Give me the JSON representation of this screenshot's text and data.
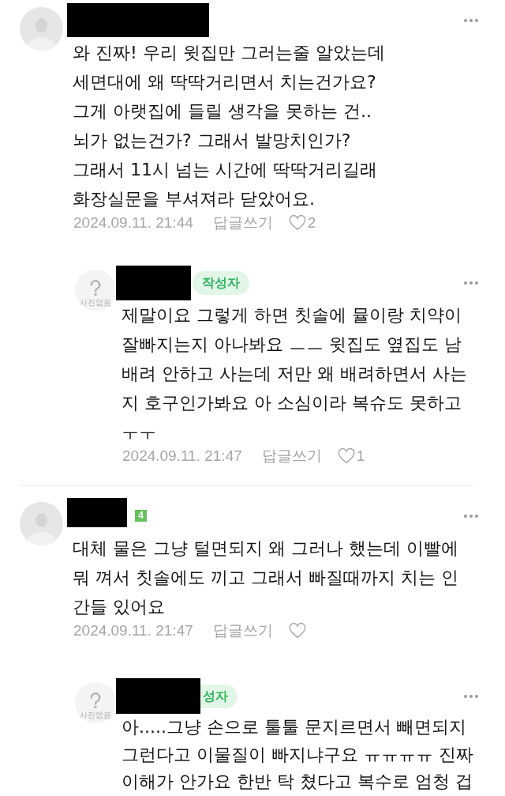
{
  "threads": [
    {
      "comment": {
        "avatar": {
          "kind": "silhouette"
        },
        "name_redacted": true,
        "text": "와 진짜! 우리 윗집만 그러는줄 알았는데\n세면대에 왜 딱딱거리면서 치는건가요?\n그게 아랫집에 들릴 생각을 못하는 건..\n뇌가 없는건가? 그래서 발망치인가?\n그래서 11시 넘는 시간에 딱딱거리길래\n화장실문을 부셔져라 닫았어요.",
        "date": "2024.09.11. 21:44",
        "reply_label": "답글쓰기",
        "likes": "2"
      },
      "replies": [
        {
          "avatar": {
            "kind": "no_photo",
            "caption": "사진없음"
          },
          "name_redacted": true,
          "author_badge": {
            "text": "작성자",
            "covered": false
          },
          "text": "제말이요 그렇게 하면 칫솔에 뮬이랑 치약이\n잘빠지는지 아나봐요 ㅡㅡ 윗집도 옆집도 남\n배려 안하고 사는데 저만 왜 배려하면서 사는\n지 호구인가봐요 아 소심이라 복슈도 못하고\nㅜㅜ",
          "date": "2024.09.11. 21:47",
          "reply_label": "답글쓰기",
          "likes": "1"
        }
      ]
    },
    {
      "comment": {
        "avatar": {
          "kind": "silhouette"
        },
        "name_redacted": true,
        "level_badge": "4",
        "text": "대체 물은 그냥 털면되지 왜 그러나 했는데 이빨에\n뭐 껴서 칫솔에도 끼고 그래서 빠질때까지 치는 인\n간들 있어요",
        "date": "2024.09.11. 21:47",
        "reply_label": "답글쓰기"
      },
      "replies": [
        {
          "avatar": {
            "kind": "no_photo",
            "caption": "사진없음"
          },
          "name_redacted": true,
          "author_badge": {
            "text": "성자",
            "covered": true
          },
          "text": "아.....그냥 손으로 툴툴 문지르면서 빼면되지\n그런다고 이물질이 빠지냐구요 ㅠㅠㅠㅠ 진짜\n이해가 안가요 한반 탁 쳤다고 복수로 엄청 겁"
        }
      ]
    }
  ]
}
